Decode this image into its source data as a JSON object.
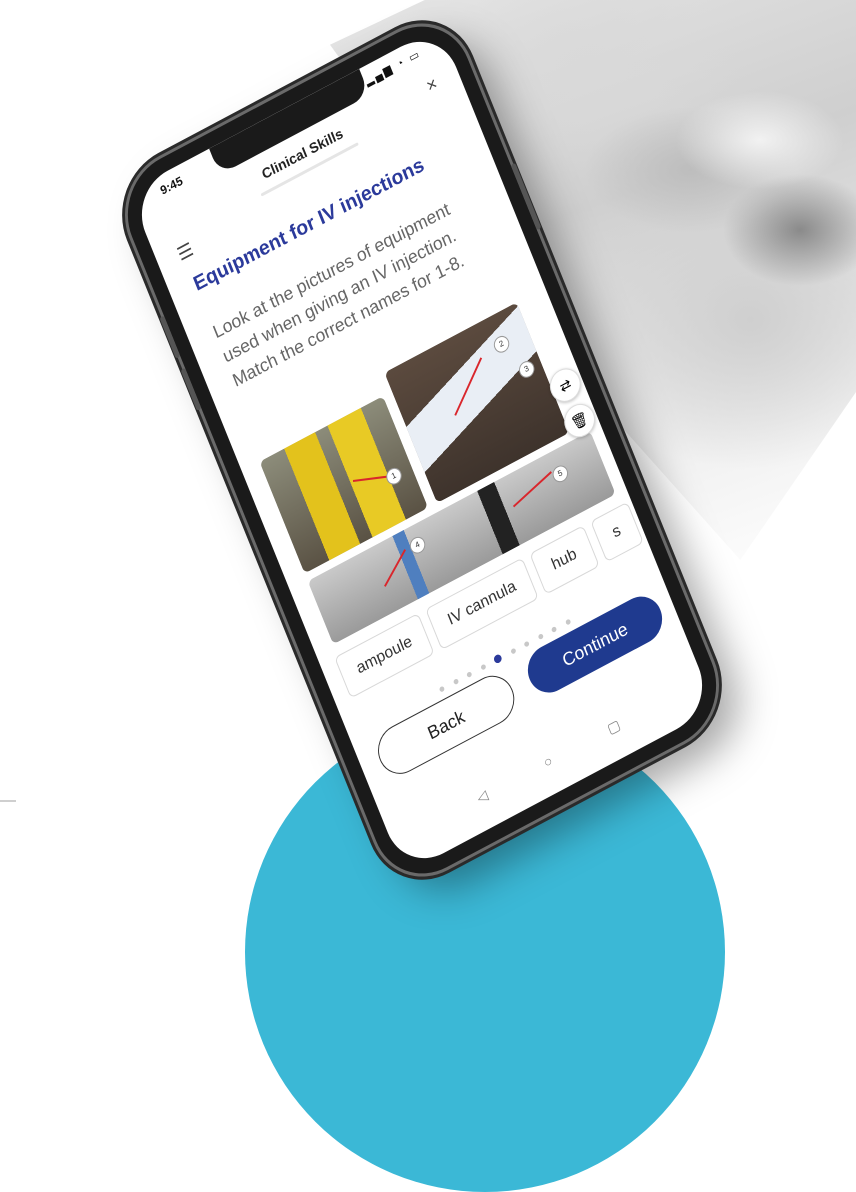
{
  "status": {
    "time": "9:45",
    "icons": "▂▄▆ ◔ ▭"
  },
  "header": {
    "title": "Clinical Skills",
    "close_icon": "×",
    "menu_icon": "☰"
  },
  "content": {
    "heading": "Equipment for IV injections",
    "instruction": "Look at the pictures of equipment used when giving an IV injection. Match the correct names for 1-8."
  },
  "images": [
    {
      "name": "sharps-bins",
      "markers": [
        "1"
      ]
    },
    {
      "name": "saline-bottle",
      "markers": [
        "2",
        "3"
      ]
    },
    {
      "name": "cannula-tray",
      "markers": [
        "4",
        "5"
      ]
    }
  ],
  "fabs": {
    "shuffle_icon": "⇄",
    "delete_icon": "🗑"
  },
  "answer_chips": [
    "ampoule",
    "IV cannula",
    "hub",
    "s"
  ],
  "pager": {
    "total": 10,
    "active": 5
  },
  "buttons": {
    "back": "Back",
    "continue": "Continue"
  },
  "navbar": {
    "back_icon": "◁",
    "home_icon": "○",
    "recent_icon": "▢"
  },
  "colors": {
    "accent": "#1f3a8f",
    "heading": "#2b3a9b",
    "circle": "#3bb8d6"
  }
}
